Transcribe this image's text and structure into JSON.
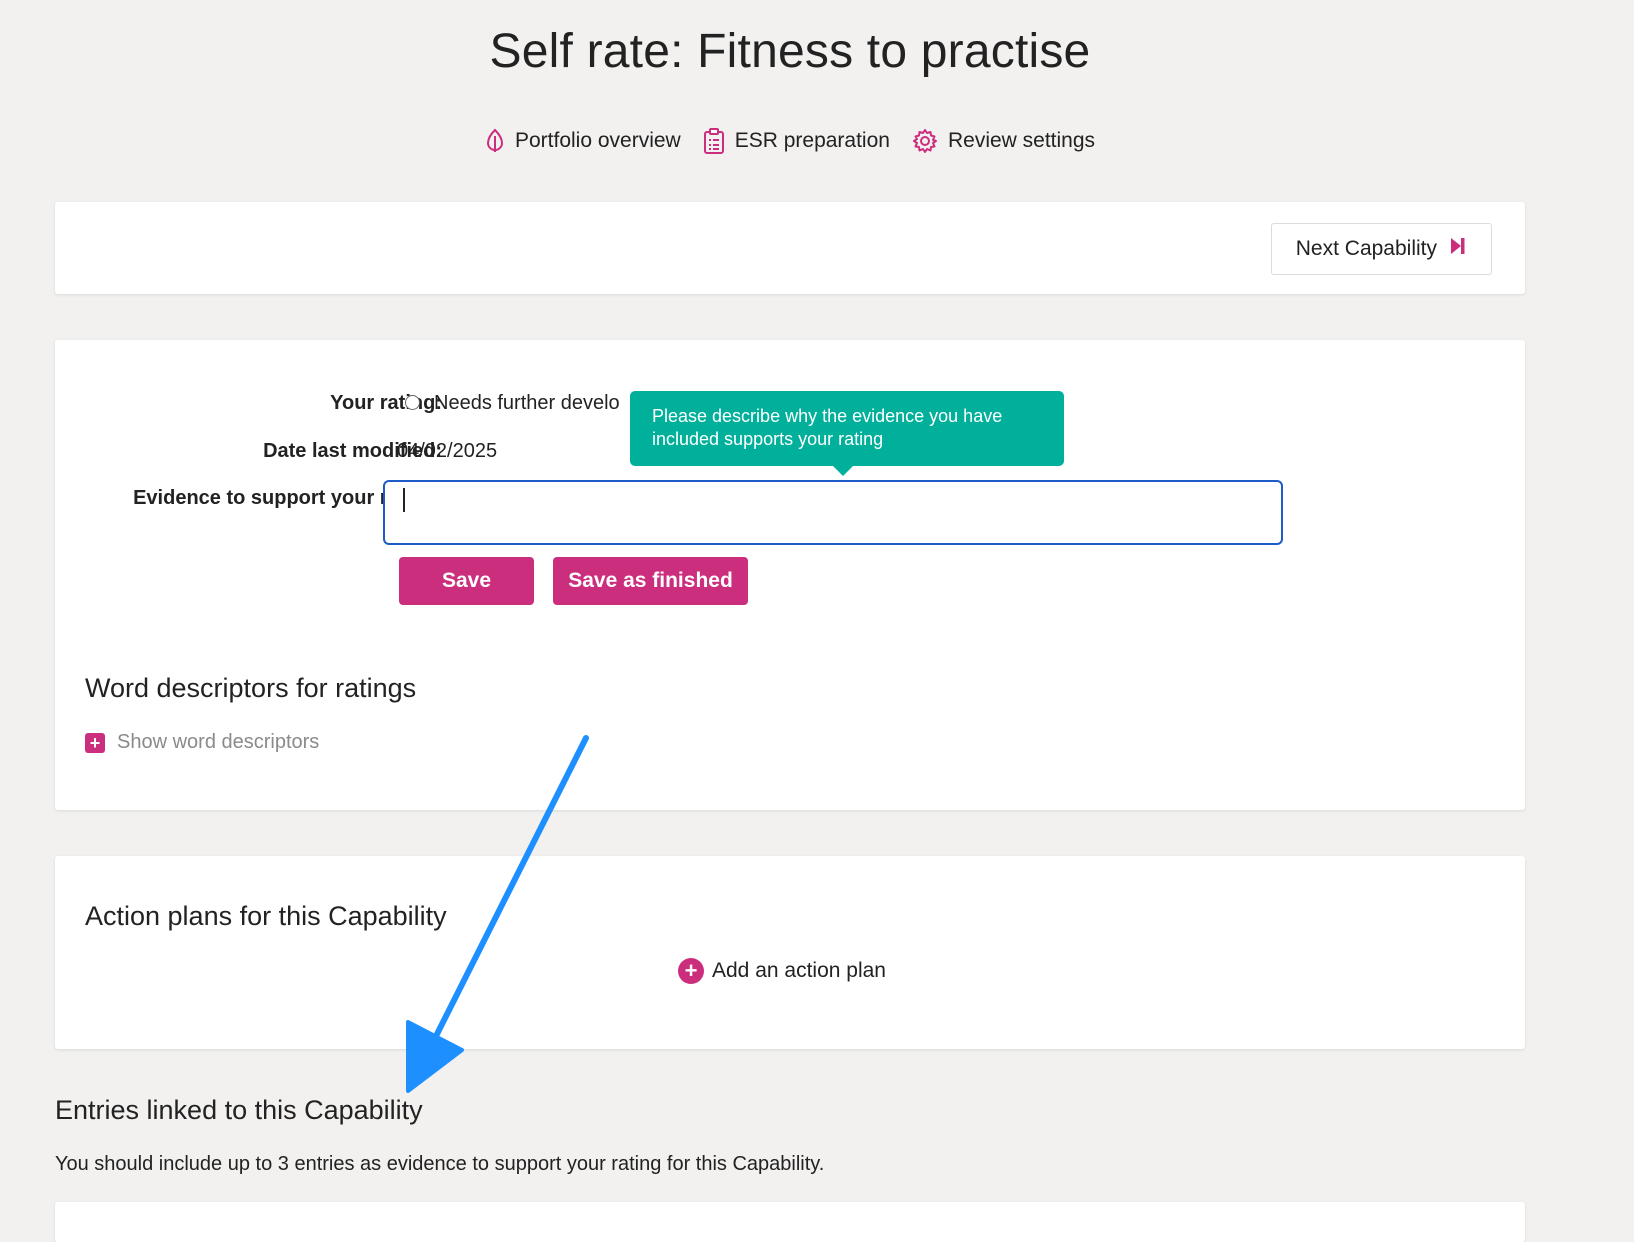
{
  "page": {
    "title": "Self rate: Fitness to practise"
  },
  "subnav": {
    "items": [
      {
        "label": "Portfolio overview",
        "icon": "leaf-icon"
      },
      {
        "label": "ESR preparation",
        "icon": "clipboard-icon"
      },
      {
        "label": "Review settings",
        "icon": "gear-icon"
      }
    ]
  },
  "navigation": {
    "next_label": "Next Capability",
    "next_icon": "skip-next-icon"
  },
  "rating_form": {
    "rating_label": "Your rating:",
    "rating_option": "Needs further develo",
    "date_label": "Date last modified:",
    "date_value": "04/02/2025",
    "evidence_label": "Evidence to support your rating:",
    "evidence_value": "",
    "save_label": "Save",
    "save_finished_label": "Save as finished",
    "tooltip_line1": "Please describe why the evidence you have",
    "tooltip_line2": "included supports your rating"
  },
  "word_descriptors": {
    "heading": "Word descriptors for ratings",
    "toggle_label": "Show word descriptors"
  },
  "action_plans": {
    "heading": "Action plans for this Capability",
    "add_label": "Add an action plan"
  },
  "entries": {
    "heading": "Entries linked to this Capability",
    "description": "You should include up to 3 entries as evidence to support your rating for this Capability."
  },
  "colors": {
    "accent": "#cc2e7e",
    "tooltip": "#00b09b",
    "annotation_arrow": "#1e8fff",
    "input_focus": "#1c5bc8",
    "background": "#f2f1f0"
  }
}
